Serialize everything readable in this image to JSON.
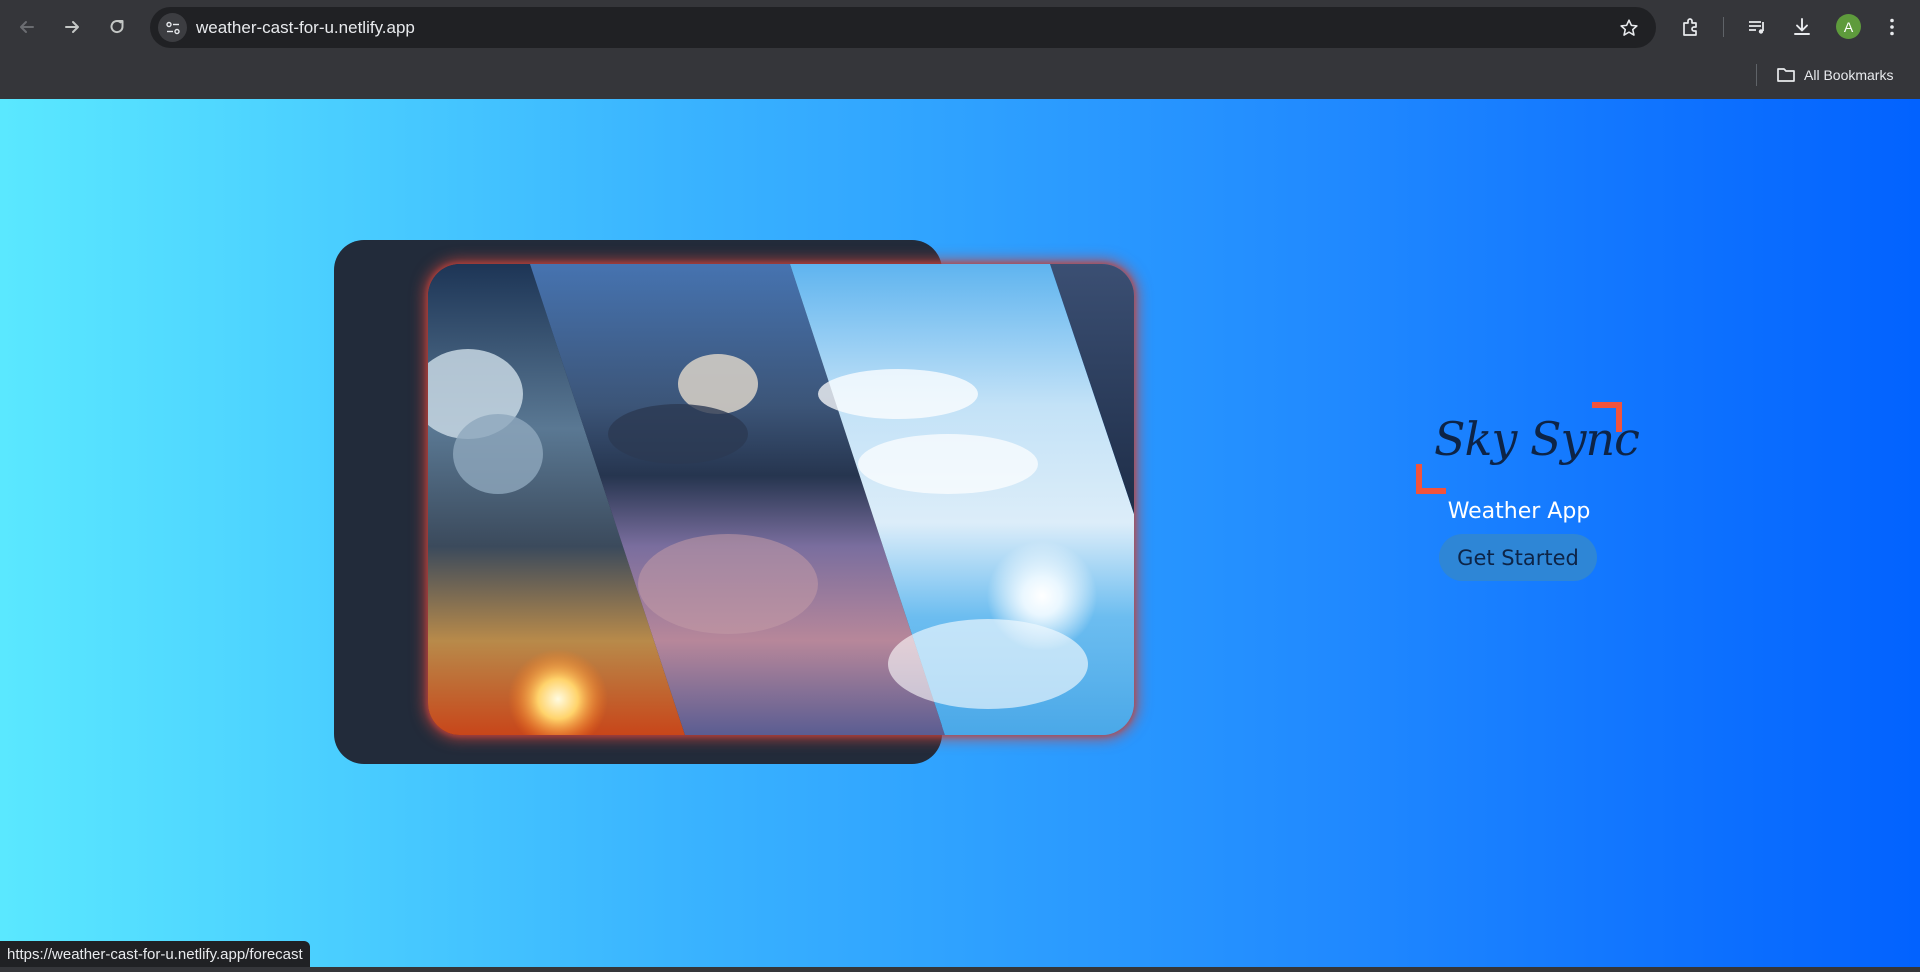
{
  "browser": {
    "url": "weather-cast-for-u.netlify.app",
    "status_url": "https://weather-cast-for-u.netlify.app/forecast",
    "avatar_letter": "A",
    "bookmarks_label": "All Bookmarks",
    "icons": [
      "back-icon",
      "forward-icon",
      "reload-icon",
      "site-info-icon",
      "star-icon",
      "extensions-icon",
      "media-icon",
      "download-icon",
      "more-icon",
      "folder-icon"
    ]
  },
  "page": {
    "brand": "Sky Sync",
    "subtitle": "Weather App",
    "cta_label": "Get Started",
    "colors": {
      "gradient_start": "#5ae8ff",
      "gradient_end": "#0262ff",
      "card": "#222b3a",
      "accent": "#f1533c",
      "button": "#2e86d6",
      "brand_text": "#0d2447"
    }
  }
}
